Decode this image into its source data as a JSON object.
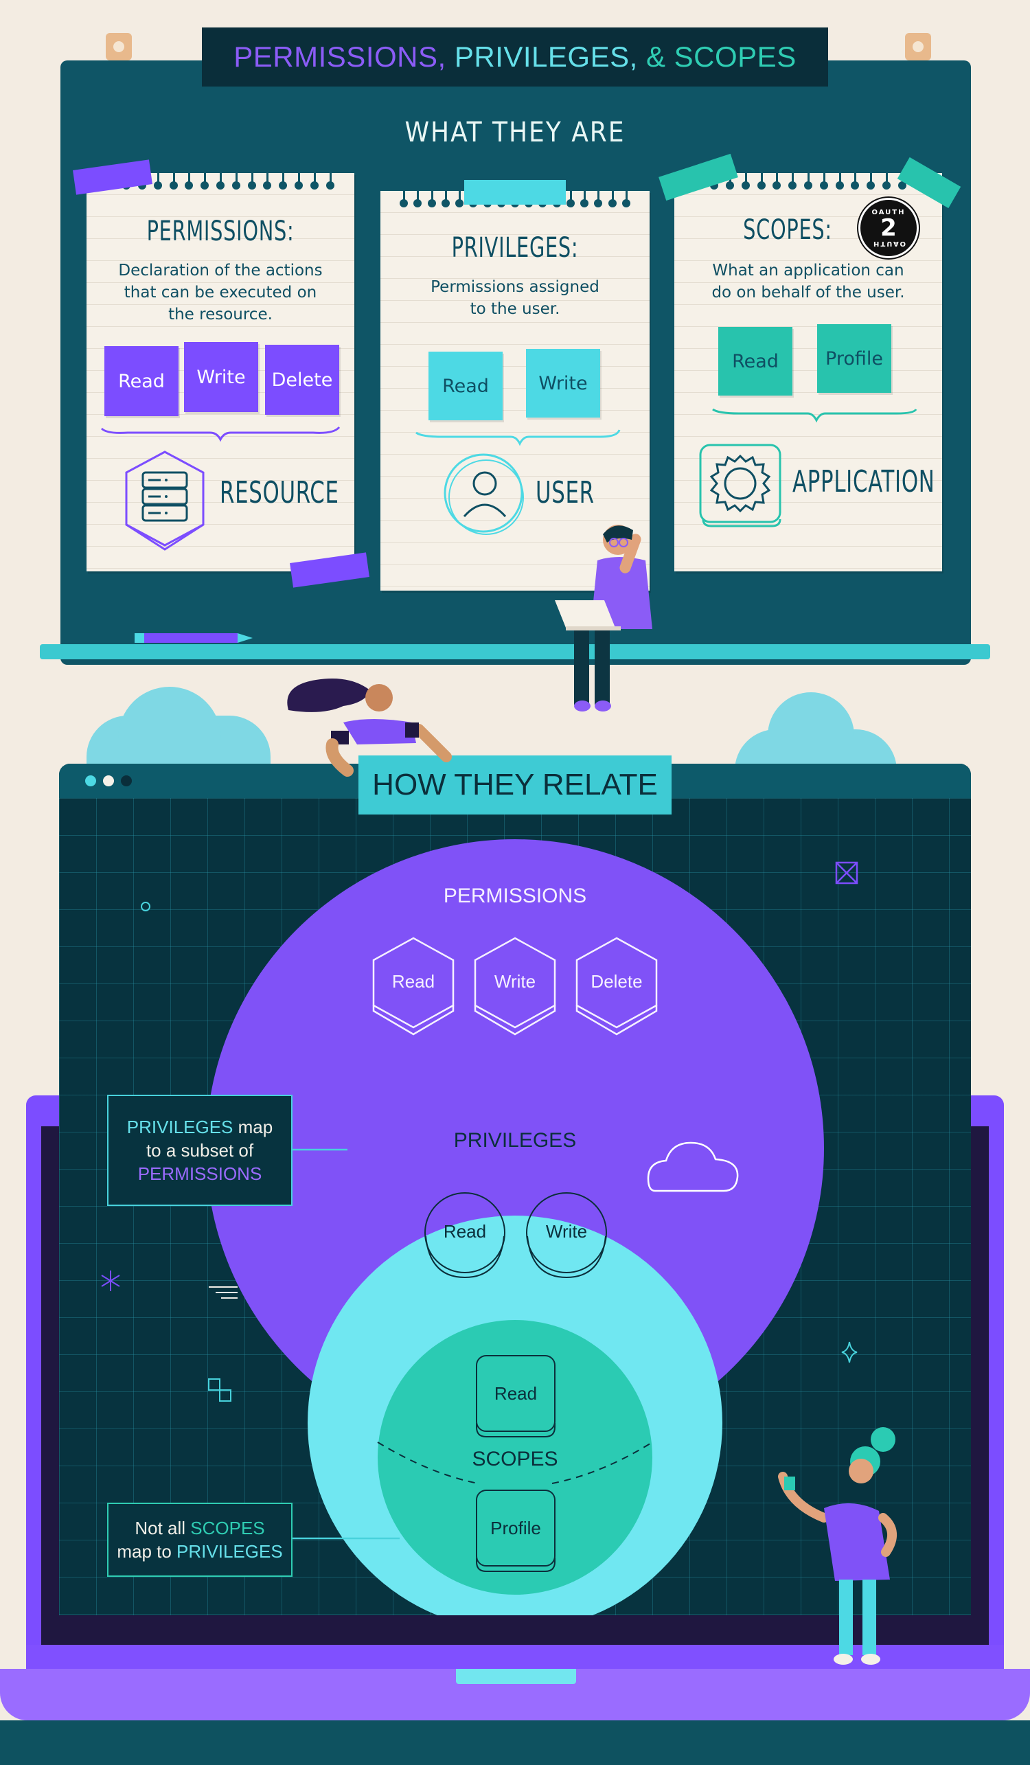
{
  "header": {
    "title_parts": [
      "PERMISSIONS,",
      "PRIVILEGES,",
      "& SCOPES"
    ]
  },
  "what_section": {
    "heading": "WHAT THEY ARE",
    "cards": [
      {
        "title": "PERMISSIONS:",
        "description": [
          "Declaration of the actions",
          "that can be executed on",
          "the resource."
        ],
        "items": [
          "Read",
          "Write",
          "Delete"
        ],
        "entity": "RESOURCE",
        "entity_icon": "server-icon"
      },
      {
        "title": "PRIVILEGES:",
        "description": [
          "Permissions assigned",
          "to the user."
        ],
        "items": [
          "Read",
          "Write"
        ],
        "entity": "USER",
        "entity_icon": "user-icon"
      },
      {
        "title": "SCOPES:",
        "description": [
          "What an application can",
          "do on behalf of the user."
        ],
        "items": [
          "Read",
          "Profile"
        ],
        "entity": "APPLICATION",
        "entity_icon": "gear-icon",
        "badge": {
          "top": "OAUTH",
          "number": "2",
          "bottom": "OAUTH"
        }
      }
    ]
  },
  "relate_section": {
    "heading": "HOW THEY RELATE",
    "permissions": {
      "label": "PERMISSIONS",
      "items": [
        "Read",
        "Write",
        "Delete"
      ]
    },
    "privileges": {
      "label": "PRIVILEGES",
      "items": [
        "Read",
        "Write"
      ]
    },
    "scopes": {
      "label": "SCOPES",
      "items": [
        "Read",
        "Profile"
      ]
    },
    "callout_privileges": {
      "part1": "PRIVILEGES",
      "part2": " map",
      "part3": "to a subset of",
      "part4": "PERMISSIONS"
    },
    "callout_scopes": {
      "part1": "Not all ",
      "part2": "SCOPES",
      "part3": "map to ",
      "part4": "PRIVILEGES"
    }
  },
  "colors": {
    "permissions": "#7c4dff",
    "privileges": "#66e0ea",
    "scopes": "#2fcdb3",
    "board": "#0f5566",
    "window": "#07333f"
  }
}
